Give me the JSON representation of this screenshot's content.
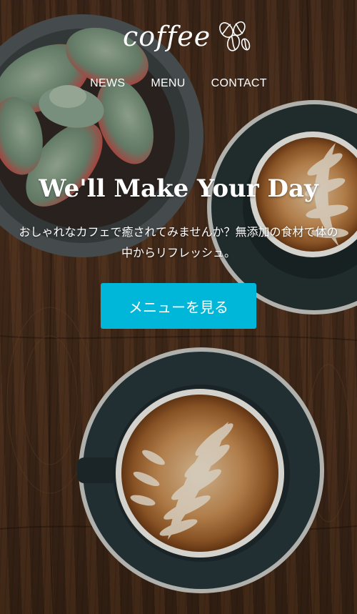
{
  "brand": {
    "logo_text": "coffee",
    "logo_icon": "coffee-beans-icon"
  },
  "nav": {
    "items": [
      "NEWS",
      "MENU",
      "CONTACT"
    ]
  },
  "hero": {
    "headline": "We'll Make Your Day",
    "lead": "おしゃれなカフェで癒されてみませんか？無添加の食材で体の中からリフレッシュ。",
    "cta_label": "メニューを見る"
  },
  "colors": {
    "accent": "#00b6d9",
    "text": "#ffffff",
    "wood": "#4a3020"
  }
}
